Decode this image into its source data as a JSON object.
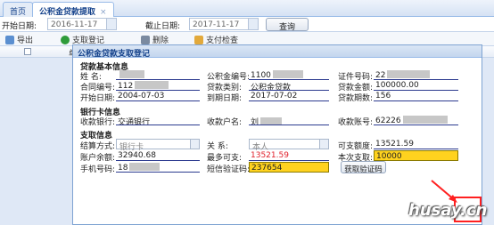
{
  "tabs": [
    {
      "label": "首页"
    },
    {
      "label": "公积金贷款提取",
      "close": "×"
    }
  ],
  "filter": {
    "start_label": "开始日期:",
    "start_value": "2016-11-17",
    "end_label": "截止日期:",
    "end_value": "2017-11-17",
    "query_label": "查询"
  },
  "toolbar": {
    "export_label": "导出",
    "register_label": "支取登记",
    "delete_label": "删除",
    "check_label": "支付检查"
  },
  "grid": {
    "col_label": "单"
  },
  "dialog": {
    "title": "公积金贷款支取登记",
    "loan_section": "贷款基本信息",
    "name_label": "姓      名:",
    "fund_no_label": "公积金编号:",
    "fund_no_value": "1100",
    "id_label": "证件号码:",
    "id_value": "22",
    "contract_label": "合同编号:",
    "contract_value": "112",
    "loan_type_label": "贷款类别:",
    "loan_type_value": "公积金贷款",
    "loan_amount_label": "贷款金额:",
    "loan_amount_value": "100000.00",
    "start_date_label": "开始日期:",
    "start_date_value": "2004-07-03",
    "due_date_label": "到期日期:",
    "due_date_value": "2017-07-02",
    "periods_label": "贷款期数:",
    "periods_value": "156",
    "bank_section": "银行卡信息",
    "bank_label": "收款银行:",
    "bank_value": "交通银行",
    "payee_label": "收款户名:",
    "payee_value": "刘",
    "account_label": "收款账号:",
    "account_value": "62226",
    "withdraw_section": "支取信息",
    "settle_label": "结算方式:",
    "settle_value": "银行卡",
    "relation_label": "关      系:",
    "relation_value": "本人",
    "withdrawable_label": "可支额度:",
    "withdrawable_value": "13521.59",
    "balance_label": "账户余额:",
    "balance_value": "32940.68",
    "max_label": "最多可支:",
    "max_value": "13521.59",
    "this_label": "本次支取:",
    "this_value": "10000",
    "phone_label": "手机号码:",
    "phone_value": "18",
    "sms_label": "短信验证码:",
    "sms_value": "237654",
    "sms_button": "获取验证码"
  },
  "watermark": "husay.cn",
  "colors": {
    "accent": "#15428b",
    "highlight": "#ffd21f",
    "alert": "#e0202a",
    "annotation": "#ff2020"
  }
}
